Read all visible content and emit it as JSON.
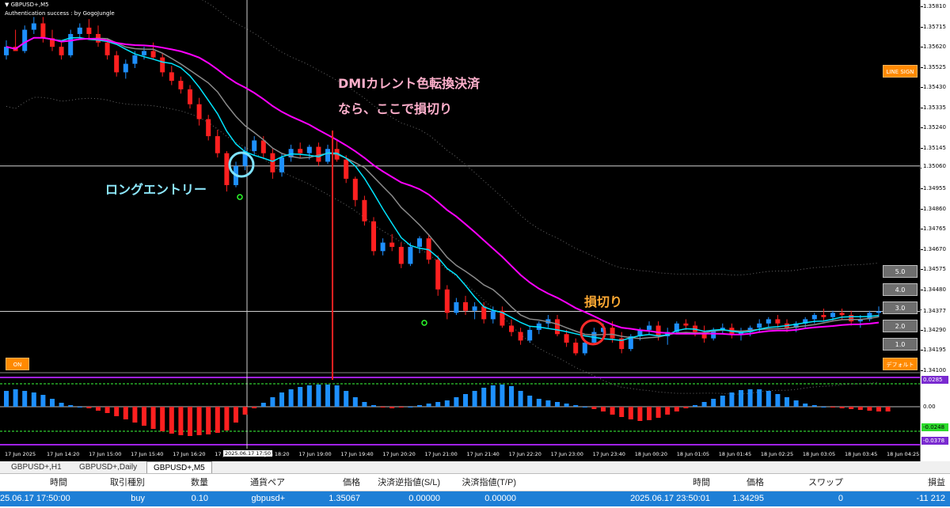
{
  "symbol_title": "GBPUSD+,M5",
  "auth_text": "Authentication success : by GogoJungle",
  "annotations": {
    "long_entry": "ロングエントリー",
    "dmi_line1": "DMIカレント色転換決済",
    "dmi_line2": "なら、ここで損切り",
    "stop_loss": "損切り"
  },
  "buttons": {
    "line_sign": "LINE SIGN",
    "on": "ON",
    "default": "デフォルト",
    "lots": [
      "5.0",
      "4.0",
      "3.0",
      "2.0",
      "1.0"
    ]
  },
  "price_axis": {
    "ticks": [
      "1.35810",
      "1.35715",
      "1.35620",
      "1.35525",
      "1.35430",
      "1.35335",
      "1.35240",
      "1.35145",
      "1.35050",
      "1.34955",
      "1.34860",
      "1.34765",
      "1.34670",
      "1.34575",
      "1.34480",
      "1.34385",
      "1.34290",
      "1.34195",
      "1.34100"
    ],
    "cursor_price": "1.35060",
    "current_price": "1.34377"
  },
  "indicator_axis": {
    "zero_label": "0.00",
    "upper_label": "0.0285",
    "lower_label": "-0.0248",
    "lower_label2": "-0.0378"
  },
  "time_axis": {
    "labels": [
      "17 Jun 2025",
      "17 Jun 14:20",
      "17 Jun 15:00",
      "17 Jun 15:40",
      "17 Jun 16:20",
      "17 Jun 17",
      "17 Jun 18:20",
      "17 Jun 19:00",
      "17 Jun 19:40",
      "17 Jun 20:20",
      "17 Jun 21:00",
      "17 Jun 21:40",
      "17 Jun 22:20",
      "17 Jun 23:00",
      "17 Jun 23:40",
      "18 Jun 00:20",
      "18 Jun 01:05",
      "18 Jun 01:45",
      "18 Jun 02:25",
      "18 Jun 03:05",
      "18 Jun 03:45",
      "18 Jun 04:25"
    ],
    "cursor_time": "2025.06.17 17:50"
  },
  "tabs": [
    "GBPUSD+,H1",
    "GBPUSD+,Daily",
    "GBPUSD+,M5"
  ],
  "trade_table": {
    "headers": [
      "時間",
      "取引種別",
      "数量",
      "通貨ペア",
      "価格",
      "決済逆指値(S/L)",
      "決済指値(T/P)",
      "時間",
      "価格",
      "スワップ",
      "損益"
    ],
    "row": [
      "25.06.17 17:50:00",
      "buy",
      "0.10",
      "gbpusd+",
      "1.35067",
      "0.00000",
      "0.00000",
      "2025.06.17 23:50:01",
      "1.34295",
      "0",
      "-11 212"
    ]
  },
  "colors": {
    "background": "#000000",
    "bull_candle": "#1e90ff",
    "bear_candle": "#ff2020",
    "ma_line": "#ff00ff",
    "fast_line": "#00e5ff",
    "slow_line": "#8a8a8a",
    "envelope": "#6a6a6a",
    "entry_circle": "#7fe3ff",
    "stop_circle": "#ff2a2a",
    "annotation_entry": "#8ee9ff",
    "annotation_dmi": "#ffb0cc",
    "annotation_stop": "#ffaa33",
    "accent_orange": "#ff8a00"
  },
  "chart_data": {
    "type": "candlestick",
    "ylim": [
      1.341,
      1.3581
    ],
    "candles": [
      {
        "o": 1.3558,
        "h": 1.3565,
        "l": 1.3556,
        "c": 1.3562
      },
      {
        "o": 1.3562,
        "h": 1.357,
        "l": 1.356,
        "c": 1.356
      },
      {
        "o": 1.356,
        "h": 1.3572,
        "l": 1.3559,
        "c": 1.357
      },
      {
        "o": 1.357,
        "h": 1.3576,
        "l": 1.3568,
        "c": 1.3573
      },
      {
        "o": 1.3573,
        "h": 1.3576,
        "l": 1.3564,
        "c": 1.3566
      },
      {
        "o": 1.3566,
        "h": 1.357,
        "l": 1.356,
        "c": 1.3562
      },
      {
        "o": 1.3562,
        "h": 1.3564,
        "l": 1.3556,
        "c": 1.3558
      },
      {
        "o": 1.3558,
        "h": 1.357,
        "l": 1.3557,
        "c": 1.3568
      },
      {
        "o": 1.3568,
        "h": 1.3573,
        "l": 1.3566,
        "c": 1.3571
      },
      {
        "o": 1.3571,
        "h": 1.3575,
        "l": 1.3566,
        "c": 1.3568
      },
      {
        "o": 1.3568,
        "h": 1.3572,
        "l": 1.3562,
        "c": 1.3564
      },
      {
        "o": 1.3564,
        "h": 1.3566,
        "l": 1.3556,
        "c": 1.3558
      },
      {
        "o": 1.3558,
        "h": 1.356,
        "l": 1.3548,
        "c": 1.355
      },
      {
        "o": 1.355,
        "h": 1.3556,
        "l": 1.3547,
        "c": 1.3554
      },
      {
        "o": 1.3554,
        "h": 1.356,
        "l": 1.3552,
        "c": 1.3558
      },
      {
        "o": 1.3558,
        "h": 1.3562,
        "l": 1.3556,
        "c": 1.356
      },
      {
        "o": 1.356,
        "h": 1.3564,
        "l": 1.3556,
        "c": 1.3557
      },
      {
        "o": 1.3557,
        "h": 1.3559,
        "l": 1.3548,
        "c": 1.355
      },
      {
        "o": 1.355,
        "h": 1.3553,
        "l": 1.3544,
        "c": 1.3546
      },
      {
        "o": 1.3546,
        "h": 1.3548,
        "l": 1.354,
        "c": 1.3542
      },
      {
        "o": 1.3542,
        "h": 1.3544,
        "l": 1.3533,
        "c": 1.3535
      },
      {
        "o": 1.3535,
        "h": 1.3538,
        "l": 1.3525,
        "c": 1.3528
      },
      {
        "o": 1.3528,
        "h": 1.353,
        "l": 1.3518,
        "c": 1.352
      },
      {
        "o": 1.352,
        "h": 1.3523,
        "l": 1.351,
        "c": 1.3512
      },
      {
        "o": 1.3512,
        "h": 1.3513,
        "l": 1.3494,
        "c": 1.3497
      },
      {
        "o": 1.3497,
        "h": 1.3508,
        "l": 1.3496,
        "c": 1.3506
      },
      {
        "o": 1.3506,
        "h": 1.3515,
        "l": 1.3504,
        "c": 1.3513
      },
      {
        "o": 1.3513,
        "h": 1.352,
        "l": 1.3511,
        "c": 1.3518
      },
      {
        "o": 1.3518,
        "h": 1.352,
        "l": 1.351,
        "c": 1.3512
      },
      {
        "o": 1.3512,
        "h": 1.3514,
        "l": 1.35,
        "c": 1.3503
      },
      {
        "o": 1.3503,
        "h": 1.3512,
        "l": 1.3501,
        "c": 1.351
      },
      {
        "o": 1.351,
        "h": 1.3516,
        "l": 1.3508,
        "c": 1.3514
      },
      {
        "o": 1.3514,
        "h": 1.3517,
        "l": 1.351,
        "c": 1.3512
      },
      {
        "o": 1.3512,
        "h": 1.3516,
        "l": 1.3509,
        "c": 1.3515
      },
      {
        "o": 1.3515,
        "h": 1.3517,
        "l": 1.3506,
        "c": 1.3508
      },
      {
        "o": 1.3508,
        "h": 1.3516,
        "l": 1.3507,
        "c": 1.3514
      },
      {
        "o": 1.3514,
        "h": 1.3518,
        "l": 1.3508,
        "c": 1.3509
      },
      {
        "o": 1.3509,
        "h": 1.3511,
        "l": 1.3498,
        "c": 1.35
      },
      {
        "o": 1.35,
        "h": 1.3501,
        "l": 1.3487,
        "c": 1.349
      },
      {
        "o": 1.349,
        "h": 1.3492,
        "l": 1.3478,
        "c": 1.348
      },
      {
        "o": 1.348,
        "h": 1.3482,
        "l": 1.3464,
        "c": 1.3466
      },
      {
        "o": 1.3466,
        "h": 1.3472,
        "l": 1.3464,
        "c": 1.347
      },
      {
        "o": 1.347,
        "h": 1.3474,
        "l": 1.3466,
        "c": 1.3468
      },
      {
        "o": 1.3468,
        "h": 1.347,
        "l": 1.3458,
        "c": 1.346
      },
      {
        "o": 1.346,
        "h": 1.347,
        "l": 1.3459,
        "c": 1.3468
      },
      {
        "o": 1.3468,
        "h": 1.3473,
        "l": 1.3465,
        "c": 1.3472
      },
      {
        "o": 1.3472,
        "h": 1.3474,
        "l": 1.346,
        "c": 1.3462
      },
      {
        "o": 1.3462,
        "h": 1.3464,
        "l": 1.3445,
        "c": 1.3448
      },
      {
        "o": 1.3448,
        "h": 1.345,
        "l": 1.3434,
        "c": 1.3437
      },
      {
        "o": 1.3437,
        "h": 1.3444,
        "l": 1.3436,
        "c": 1.3442
      },
      {
        "o": 1.3442,
        "h": 1.3445,
        "l": 1.3436,
        "c": 1.3438
      },
      {
        "o": 1.3438,
        "h": 1.3442,
        "l": 1.3434,
        "c": 1.344
      },
      {
        "o": 1.344,
        "h": 1.3442,
        "l": 1.3432,
        "c": 1.3434
      },
      {
        "o": 1.3434,
        "h": 1.344,
        "l": 1.3432,
        "c": 1.3438
      },
      {
        "o": 1.3438,
        "h": 1.344,
        "l": 1.343,
        "c": 1.3431
      },
      {
        "o": 1.3431,
        "h": 1.3434,
        "l": 1.3426,
        "c": 1.3428
      },
      {
        "o": 1.3428,
        "h": 1.343,
        "l": 1.3422,
        "c": 1.3424
      },
      {
        "o": 1.3424,
        "h": 1.3431,
        "l": 1.3423,
        "c": 1.3429
      },
      {
        "o": 1.3429,
        "h": 1.3433,
        "l": 1.3427,
        "c": 1.3432
      },
      {
        "o": 1.3432,
        "h": 1.3436,
        "l": 1.343,
        "c": 1.3434
      },
      {
        "o": 1.3434,
        "h": 1.3436,
        "l": 1.3426,
        "c": 1.3427
      },
      {
        "o": 1.3427,
        "h": 1.3429,
        "l": 1.3421,
        "c": 1.3423
      },
      {
        "o": 1.3423,
        "h": 1.3425,
        "l": 1.3417,
        "c": 1.3418
      },
      {
        "o": 1.3418,
        "h": 1.3424,
        "l": 1.3417,
        "c": 1.3423
      },
      {
        "o": 1.3423,
        "h": 1.343,
        "l": 1.3422,
        "c": 1.3428
      },
      {
        "o": 1.3428,
        "h": 1.3432,
        "l": 1.3426,
        "c": 1.343
      },
      {
        "o": 1.343,
        "h": 1.3433,
        "l": 1.3423,
        "c": 1.3425
      },
      {
        "o": 1.3425,
        "h": 1.3428,
        "l": 1.3418,
        "c": 1.342
      },
      {
        "o": 1.342,
        "h": 1.3427,
        "l": 1.3419,
        "c": 1.3426
      },
      {
        "o": 1.3426,
        "h": 1.343,
        "l": 1.3424,
        "c": 1.3429
      },
      {
        "o": 1.3429,
        "h": 1.3433,
        "l": 1.3427,
        "c": 1.3431
      },
      {
        "o": 1.3431,
        "h": 1.3433,
        "l": 1.3424,
        "c": 1.3426
      },
      {
        "o": 1.3426,
        "h": 1.343,
        "l": 1.3422,
        "c": 1.3428
      },
      {
        "o": 1.3428,
        "h": 1.3433,
        "l": 1.3427,
        "c": 1.3432
      },
      {
        "o": 1.3432,
        "h": 1.3434,
        "l": 1.3429,
        "c": 1.3431
      },
      {
        "o": 1.3431,
        "h": 1.3433,
        "l": 1.3426,
        "c": 1.3428
      },
      {
        "o": 1.3428,
        "h": 1.3431,
        "l": 1.3423,
        "c": 1.3425
      },
      {
        "o": 1.3425,
        "h": 1.343,
        "l": 1.3424,
        "c": 1.3429
      },
      {
        "o": 1.3429,
        "h": 1.3432,
        "l": 1.3427,
        "c": 1.343
      },
      {
        "o": 1.343,
        "h": 1.3432,
        "l": 1.3425,
        "c": 1.3427
      },
      {
        "o": 1.3427,
        "h": 1.343,
        "l": 1.3424,
        "c": 1.3428
      },
      {
        "o": 1.3428,
        "h": 1.3431,
        "l": 1.3426,
        "c": 1.343
      },
      {
        "o": 1.343,
        "h": 1.3434,
        "l": 1.3428,
        "c": 1.3432
      },
      {
        "o": 1.3432,
        "h": 1.3435,
        "l": 1.343,
        "c": 1.3434
      },
      {
        "o": 1.3434,
        "h": 1.3436,
        "l": 1.343,
        "c": 1.3432
      },
      {
        "o": 1.3432,
        "h": 1.3434,
        "l": 1.3428,
        "c": 1.343
      },
      {
        "o": 1.343,
        "h": 1.3433,
        "l": 1.3428,
        "c": 1.3432
      },
      {
        "o": 1.3432,
        "h": 1.3435,
        "l": 1.343,
        "c": 1.3434
      },
      {
        "o": 1.3434,
        "h": 1.3437,
        "l": 1.3432,
        "c": 1.3436
      },
      {
        "o": 1.3436,
        "h": 1.3439,
        "l": 1.3433,
        "c": 1.3435
      },
      {
        "o": 1.3435,
        "h": 1.3438,
        "l": 1.3433,
        "c": 1.3437
      },
      {
        "o": 1.3437,
        "h": 1.3439,
        "l": 1.3434,
        "c": 1.3436
      },
      {
        "o": 1.3436,
        "h": 1.3438,
        "l": 1.3431,
        "c": 1.3433
      },
      {
        "o": 1.3433,
        "h": 1.3436,
        "l": 1.343,
        "c": 1.3434
      },
      {
        "o": 1.3434,
        "h": 1.3438,
        "l": 1.3433,
        "c": 1.3437
      },
      {
        "o": 1.3437,
        "h": 1.344,
        "l": 1.3435,
        "c": 1.34377
      }
    ],
    "histogram": [
      0.02,
      0.022,
      0.02,
      0.018,
      0.015,
      0.01,
      0.005,
      0.002,
      0,
      -0.002,
      -0.005,
      -0.008,
      -0.012,
      -0.016,
      -0.02,
      -0.024,
      -0.028,
      -0.031,
      -0.034,
      -0.036,
      -0.037,
      -0.036,
      -0.035,
      -0.033,
      -0.03,
      -0.02,
      -0.01,
      -0.002,
      0.005,
      0.012,
      0.018,
      0.022,
      0.025,
      0.027,
      0.028,
      0.028,
      0.027,
      0.02,
      0.012,
      0.006,
      0.002,
      -0.001,
      -0.002,
      -0.001,
      0,
      0.002,
      0.004,
      0.006,
      0.008,
      0.012,
      0.016,
      0.02,
      0.024,
      0.027,
      0.028,
      0.026,
      0.02,
      0.014,
      0.01,
      0.008,
      0.006,
      0.004,
      0.002,
      0,
      -0.003,
      -0.006,
      -0.01,
      -0.013,
      -0.016,
      -0.018,
      -0.017,
      -0.014,
      -0.01,
      -0.006,
      -0.002,
      0.002,
      0.006,
      0.01,
      0.014,
      0.018,
      0.021,
      0.022,
      0.022,
      0.02,
      0.016,
      0.012,
      0.008,
      0.004,
      0.002,
      0,
      -0.001,
      -0.002,
      -0.003,
      -0.004,
      -0.005,
      -0.006,
      -0.006
    ]
  }
}
